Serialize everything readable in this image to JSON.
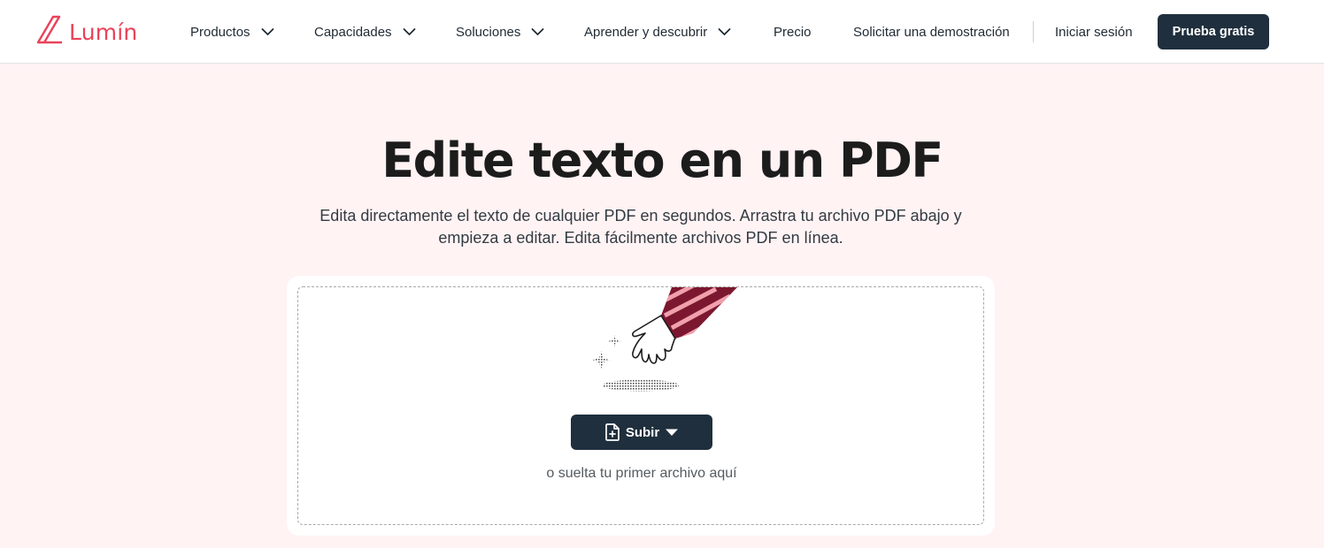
{
  "brand": {
    "name": "Lumín",
    "color": "#e8435a"
  },
  "nav": {
    "items": [
      {
        "label": "Productos",
        "has_dropdown": true
      },
      {
        "label": "Capacidades",
        "has_dropdown": true
      },
      {
        "label": "Soluciones",
        "has_dropdown": true
      },
      {
        "label": "Aprender y descubrir",
        "has_dropdown": true
      },
      {
        "label": "Precio",
        "has_dropdown": false
      },
      {
        "label": "Solicitar una demostración",
        "has_dropdown": false
      }
    ],
    "login_label": "Iniciar sesión",
    "cta_label": "Prueba gratis"
  },
  "hero": {
    "title": "Edite texto en un PDF",
    "subtitle": "Edita directamente el texto de cualquier PDF en segundos. Arrastra tu archivo PDF abajo y empieza a editar. Edita fácilmente archivos PDF en línea."
  },
  "upload": {
    "button_label": "Subir",
    "drop_hint": "o suelta tu primer archivo aquí"
  },
  "icons": {
    "logo": "lumin-logo-icon",
    "chevrons": "chevron-down-icon",
    "upload": "file-plus-icon",
    "caret": "caret-down-icon"
  },
  "colors": {
    "page_background": "#fff3f4",
    "dark_button": "#1f2f3d",
    "accent": "#e8435a",
    "sleeve": "#7b1830"
  }
}
